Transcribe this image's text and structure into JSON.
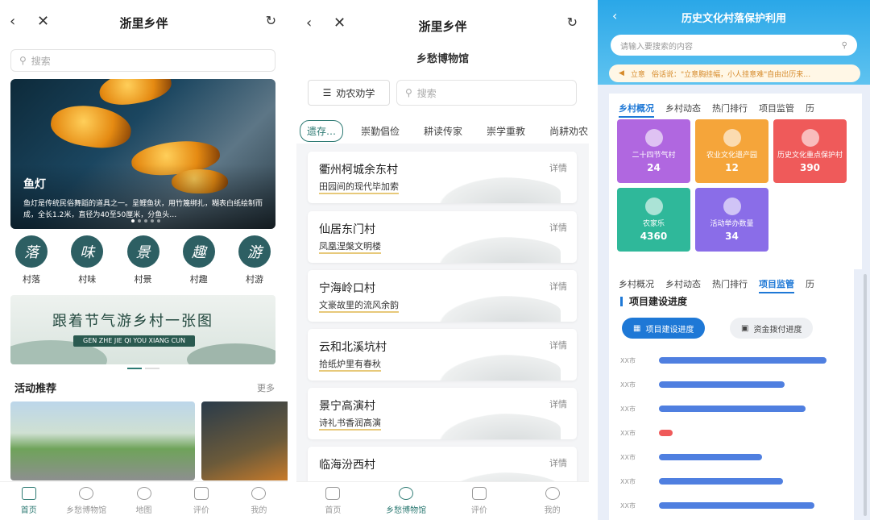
{
  "phone1": {
    "title": "浙里乡伴",
    "search_placeholder": "搜索",
    "hero": {
      "title": "鱼灯",
      "desc": "鱼灯是传统民俗舞蹈的道具之一。呈鲤鱼状，用竹篾绑扎，糊表白纸绘制而成，全长1.2米，直径为40至50厘米，分鱼头…"
    },
    "categories": [
      {
        "glyph": "落",
        "label": "村落"
      },
      {
        "glyph": "味",
        "label": "村味"
      },
      {
        "glyph": "景",
        "label": "村景"
      },
      {
        "glyph": "趣",
        "label": "村趣"
      },
      {
        "glyph": "游",
        "label": "村游"
      }
    ],
    "banner": {
      "title": "跟着节气游乡村一张图",
      "subtitle": "GEN ZHE JIE QI YOU XIANG CUN"
    },
    "section_title": "活动推荐",
    "more": "更多",
    "tabbar": [
      "首页",
      "乡愁博物馆",
      "地图",
      "评价",
      "我的"
    ]
  },
  "phone2": {
    "title": "浙里乡伴",
    "subtitle": "乡愁博物馆",
    "menu_label": "劝农劝学",
    "search_placeholder": "搜索",
    "tabs": [
      "遗存…",
      "崇勤倡俭",
      "耕读传家",
      "崇学重教",
      "尚耕劝农"
    ],
    "detail": "详情",
    "cards": [
      {
        "name": "衢州柯城余东村",
        "sub": "田园间的现代毕加索"
      },
      {
        "name": "仙居东门村",
        "sub": "凤凰涅槃文明楼"
      },
      {
        "name": "宁海岭口村",
        "sub": "文豪故里的流风余韵"
      },
      {
        "name": "云和北溪坑村",
        "sub": "拾纸炉里有春秋"
      },
      {
        "name": "景宁高演村",
        "sub": "诗礼书香润高演"
      },
      {
        "name": "临海汾西村",
        "sub": ""
      }
    ],
    "tabbar": [
      "首页",
      "乡愁博物馆",
      "评价",
      "我的"
    ]
  },
  "phone3": {
    "title": "历史文化村落保护利用",
    "search_placeholder": "请输入要搜索的内容",
    "notice_tag": "立意",
    "notice_text": "俗话说：\"立意胸挂幅，小人挂意难\"自由出历来…",
    "tabs": [
      "乡村概况",
      "乡村动态",
      "热门排行",
      "项目监管",
      "历"
    ],
    "tiles": [
      {
        "label": "二十四节气村",
        "value": "24",
        "color": "#b067e0"
      },
      {
        "label": "农业文化遗产园",
        "value": "12",
        "color": "#f5a53a"
      },
      {
        "label": "历史文化重点保护村",
        "value": "390",
        "color": "#ef5a5a"
      },
      {
        "label": "农家乐",
        "value": "4360",
        "color": "#2fb89a"
      },
      {
        "label": "活动举办数量",
        "value": "34",
        "color": "#8a6de8"
      }
    ],
    "tabs2": [
      "乡村概况",
      "乡村动态",
      "热门排行",
      "项目监管",
      "历"
    ],
    "section_title": "项目建设进度",
    "pill_a": "项目建设进度",
    "pill_b": "资金拨付进度",
    "bar_labels": [
      "XX市",
      "XX市",
      "XX市",
      "XX市",
      "XX市",
      "XX市",
      "XX市"
    ],
    "bar_values": [
      0.97,
      0.73,
      0.85,
      0.08,
      0.6,
      0.72,
      0.9
    ],
    "accent": "#1e78d6"
  }
}
